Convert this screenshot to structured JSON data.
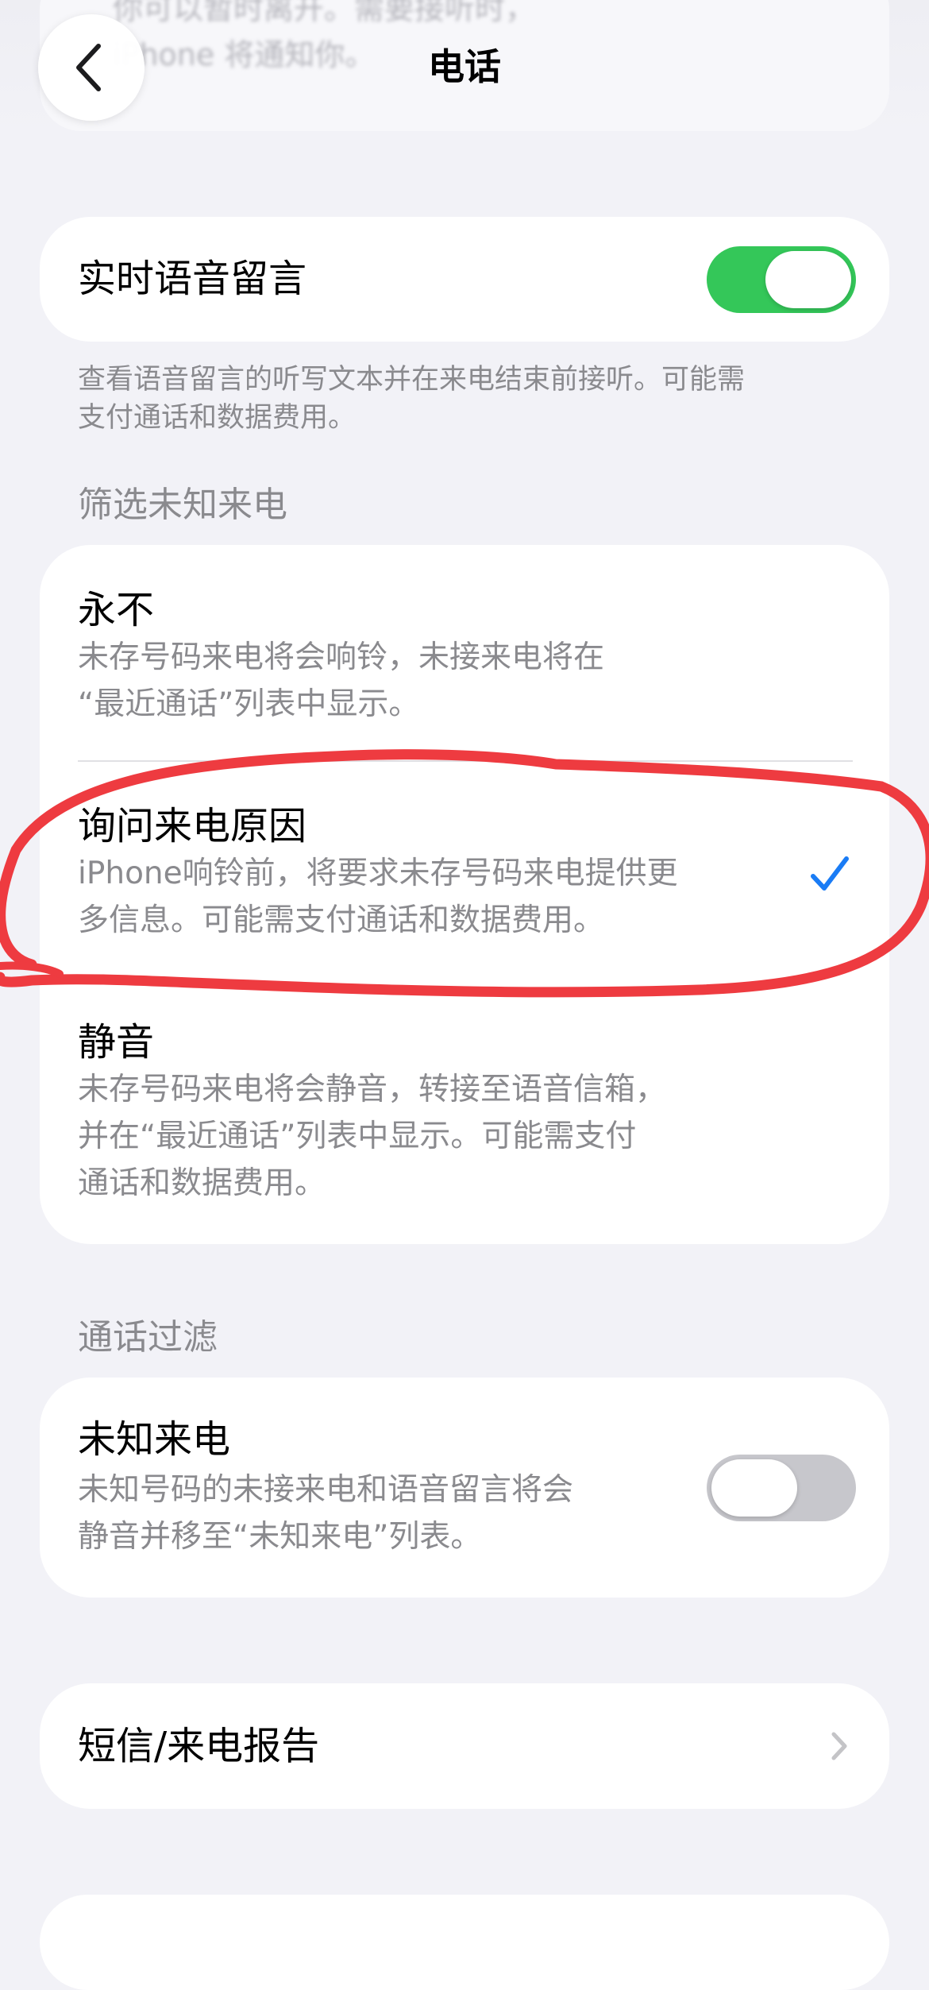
{
  "header": {
    "title": "电话",
    "ghost_text": "你可以暂时离开。需要接听时，iPhone 将通知你。"
  },
  "live_voicemail": {
    "label": "实时语音留言",
    "toggle_on": true,
    "footer": "查看语音留言的听写文本并在来电结束前接听。可能需\n支付通话和数据费用。"
  },
  "screen_unknown": {
    "header": "筛选未知来电",
    "options": [
      {
        "title": "永不",
        "description": "未存号码来电将会响铃，未接来电将在\n“最近通话”列表中显示。",
        "selected": false
      },
      {
        "title": "询问来电原因",
        "description": "iPhone响铃前，将要求未存号码来电提供更\n多信息。可能需支付通话和数据费用。",
        "selected": true
      },
      {
        "title": "静音",
        "description": "未存号码来电将会静音，转接至语音信箱，\n并在“最近通话”列表中显示。可能需支付\n通话和数据费用。",
        "selected": false
      }
    ]
  },
  "call_filtering": {
    "header": "通话过滤",
    "unknown_callers": {
      "title": "未知来电",
      "description": "未知号码的未接来电和语音留言将会\n静音并移至“未知来电”列表。",
      "toggle_on": false
    }
  },
  "sms_report": {
    "label": "短信/来电报告"
  },
  "colors": {
    "background": "#f2f2f7",
    "toggle_on": "#34c759",
    "toggle_off": "#c7c7cc",
    "checkmark": "#1a7cf5",
    "annotation": "#ee3b40"
  }
}
